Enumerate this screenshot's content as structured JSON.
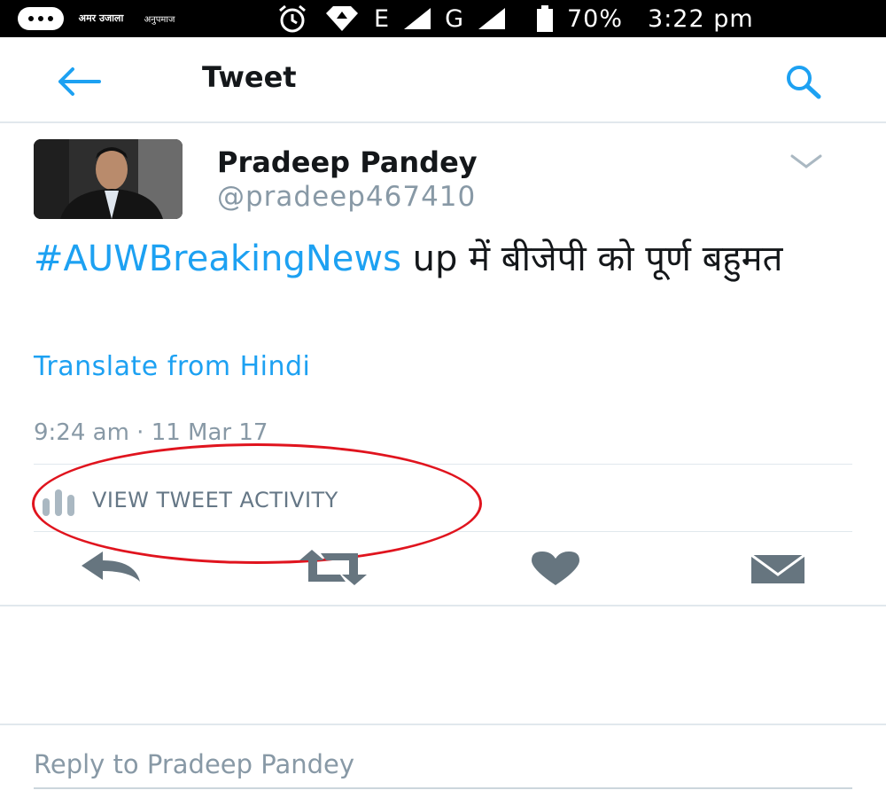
{
  "status_bar": {
    "notification_app_1": "अमर उजाला",
    "notification_app_2": "अनुपमाज",
    "network_1": "E",
    "network_2": "G",
    "battery": "70%",
    "time": "3:22 pm",
    "icons": [
      "more-icon",
      "alarm-icon",
      "data-saver-icon",
      "signal-icon",
      "battery-icon"
    ]
  },
  "app_bar": {
    "title": "Tweet",
    "back_icon": "arrow-left-icon",
    "search_icon": "search-icon"
  },
  "tweet": {
    "author_name": "Pradeep Pandey",
    "author_handle": "@pradeep467410",
    "hashtag": "#AUWBreakingNews",
    "text": " up में बीजेपी को पूर्ण बहुमत",
    "translate_label": "Translate from Hindi",
    "timestamp": "9:24 am · 11 Mar 17",
    "activity_label": "VIEW TWEET ACTIVITY"
  },
  "actions": {
    "reply": "reply-icon",
    "retweet": "retweet-icon",
    "like": "heart-icon",
    "dm": "envelope-icon"
  },
  "reply_box": {
    "placeholder": "Reply to Pradeep Pandey"
  },
  "colors": {
    "accent": "#1da1f2",
    "secondary_text": "#8899a6",
    "action_icon": "#66757f",
    "annotation": "#e0141e"
  }
}
